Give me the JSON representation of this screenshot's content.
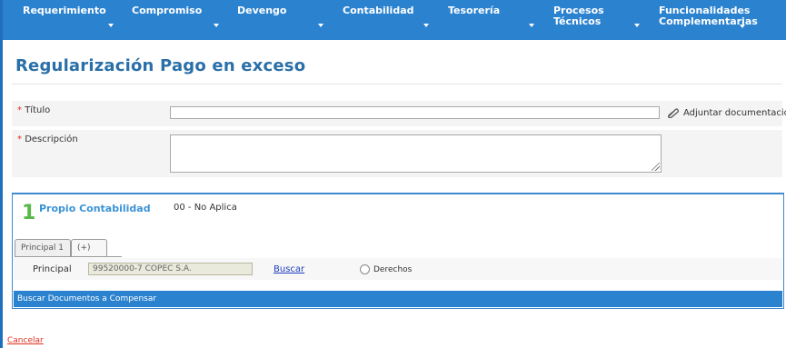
{
  "nav": {
    "items": [
      {
        "line1": "Requerimiento",
        "line2": ""
      },
      {
        "line1": "Compromiso",
        "line2": ""
      },
      {
        "line1": "Devengo",
        "line2": ""
      },
      {
        "line1": "Contabilidad",
        "line2": ""
      },
      {
        "line1": "Tesorería",
        "line2": ""
      },
      {
        "line1": "Procesos",
        "line2": "Técnicos"
      },
      {
        "line1": "Funcionalidades",
        "line2": "Complementarias"
      }
    ],
    "caret_icon": "chevron-down-icon",
    "background": "#2b82cf"
  },
  "page": {
    "title": "Regularización Pago en exceso"
  },
  "form": {
    "required_mark": "*",
    "titulo_label": "Título",
    "titulo_value": "",
    "descripcion_label": "Descripción",
    "descripcion_value": "",
    "attach_label": "Adjuntar documentación",
    "attach_icon": "paperclip-icon"
  },
  "panel": {
    "step_number": "1",
    "step_title": "Propio Contabilidad",
    "step_value": "00 - No Aplica",
    "tabs": [
      "Principal 1",
      "(+)"
    ],
    "principal_label": "Principal",
    "principal_value": "99520000-7 COPEC S.A.",
    "buscar_label": "Buscar",
    "radio_label": "Derechos",
    "section_title": "Buscar Documentos a Compensar"
  },
  "footer": {
    "cancel_label": "Cancelar"
  },
  "colors": {
    "accent": "#2b82cf",
    "title": "#2a6fa8",
    "required": "#e03020",
    "step_number": "#58b84a"
  }
}
